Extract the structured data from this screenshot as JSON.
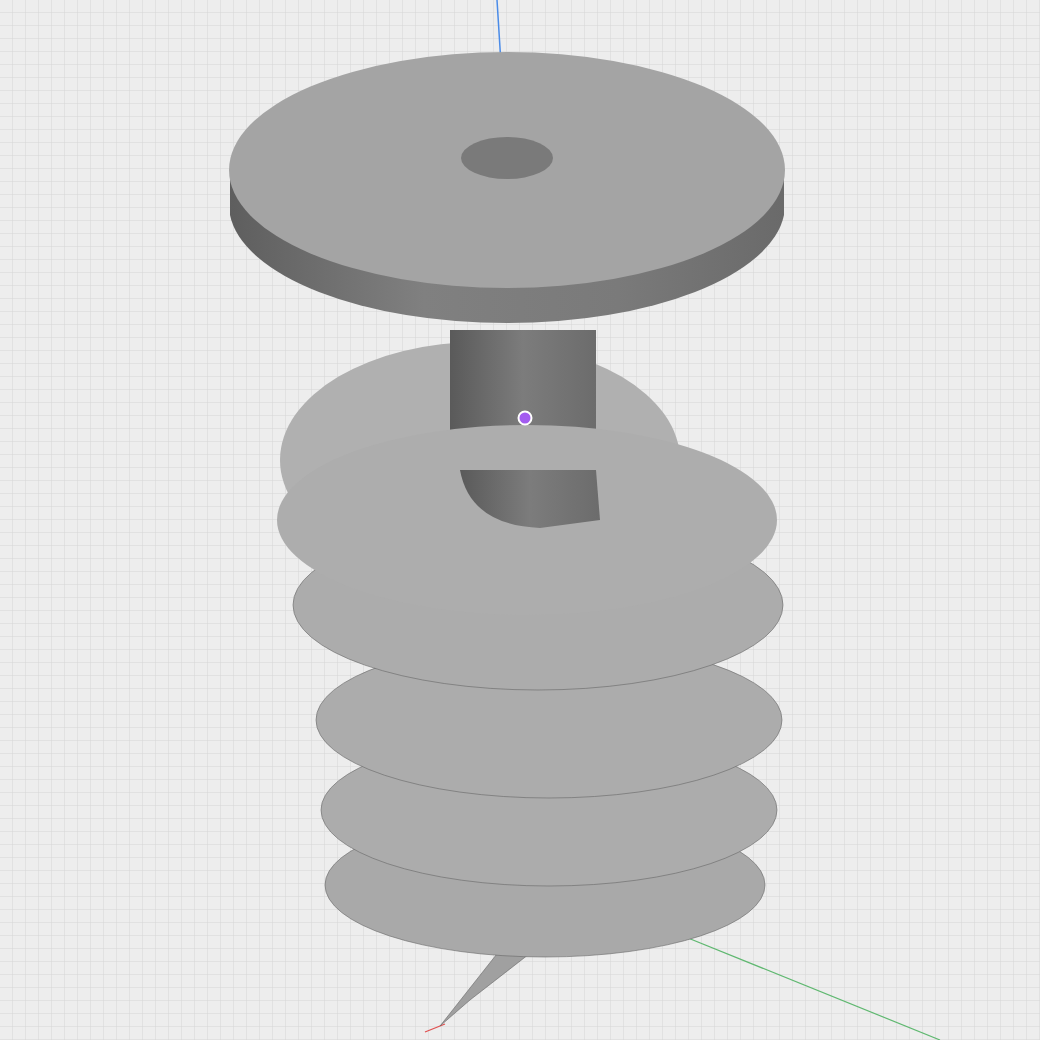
{
  "viewport": {
    "grid_visible": true,
    "axes_visible": true,
    "pivot_visible": true
  }
}
